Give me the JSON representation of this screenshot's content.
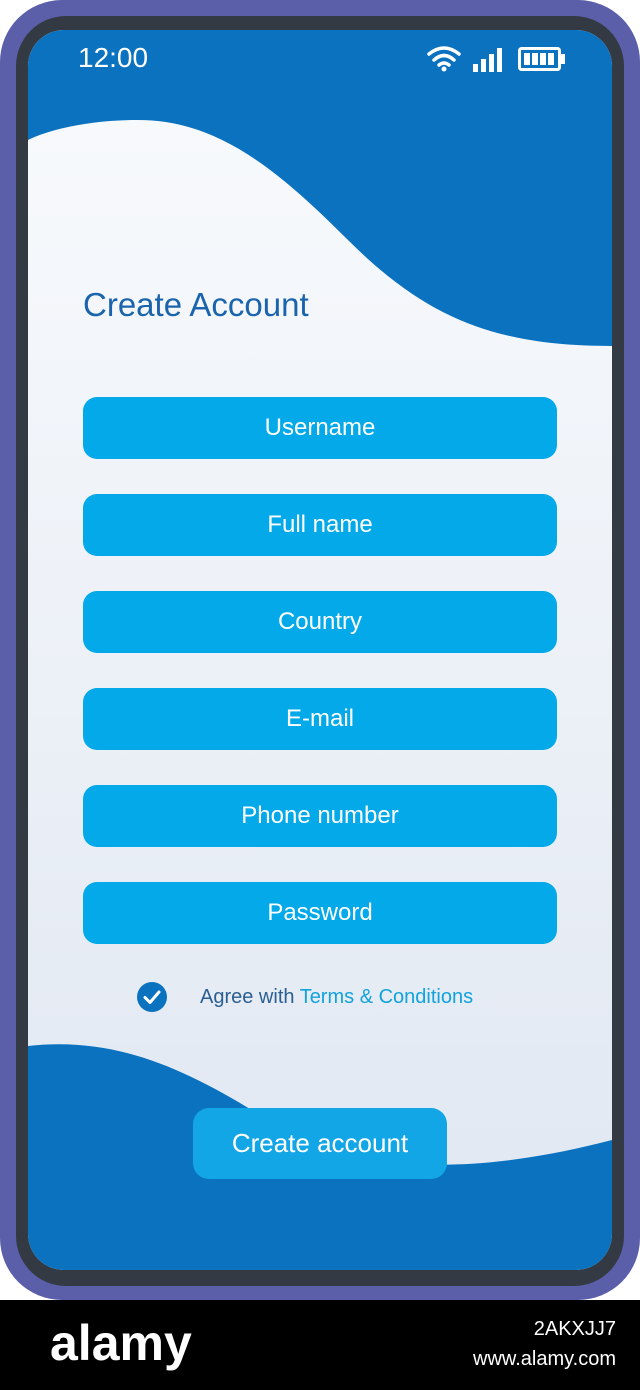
{
  "status_bar": {
    "time": "12:00"
  },
  "title": "Create Account",
  "fields": [
    {
      "placeholder": "Username"
    },
    {
      "placeholder": "Full name"
    },
    {
      "placeholder": "Country"
    },
    {
      "placeholder": "E-mail"
    },
    {
      "placeholder": "Phone number"
    },
    {
      "placeholder": "Password"
    }
  ],
  "agreement": {
    "checked": true,
    "prefix": "Agree with ",
    "link": "Terms & Conditions"
  },
  "submit_label": "Create account",
  "watermark": {
    "logo": "alamy",
    "image_id": "2AKXJJ7",
    "url": "www.alamy.com"
  },
  "colors": {
    "frame": "#5b5fa9",
    "wave_blue": "#0b72bf",
    "field": "#03a9e8",
    "title": "#1a64ad",
    "link": "#12a2dd"
  }
}
